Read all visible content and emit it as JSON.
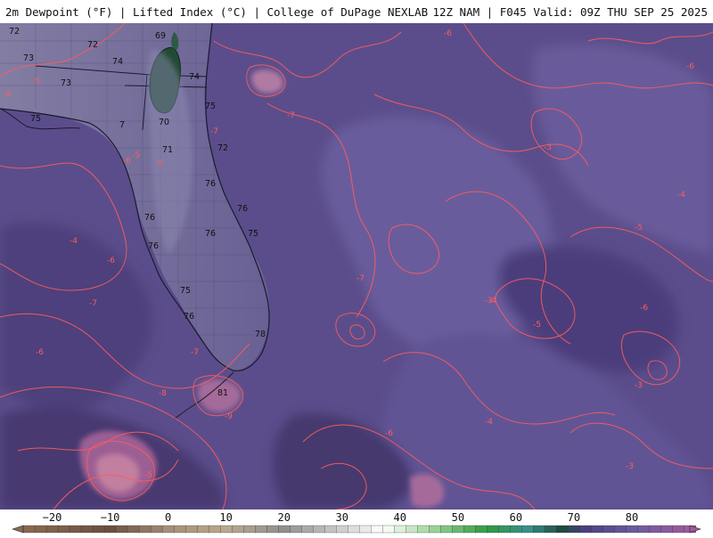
{
  "header": {
    "left": "2m Dewpoint (°F) | Lifted Index (°C) | College of DuPage NEXLAB",
    "right": "12Z NAM | F045 Valid: 09Z THU SEP 25 2025"
  },
  "colors": {
    "background_fill": "#5a4c8a",
    "fill_low_dew": "#4a3d76",
    "fill_mid_dew": "#6a5a9a",
    "fill_high_dew": "#8f5a8a",
    "fill_highest_dew": "#c07a9a",
    "fill_dry_core": "#234a36",
    "li_contour": "#ff5c5c",
    "land_outline": "#1a1a2e"
  },
  "colorbar": {
    "tick_labels": [
      "−20",
      "−10",
      "0",
      "10",
      "20",
      "30",
      "40",
      "50",
      "60",
      "70",
      "80"
    ],
    "tick_values": [
      -20,
      -10,
      0,
      10,
      20,
      30,
      40,
      50,
      60,
      70,
      80
    ],
    "range": [
      -25,
      90
    ],
    "stops": [
      {
        "v": -25,
        "c": "#8a6a52"
      },
      {
        "v": -10,
        "c": "#6b5040"
      },
      {
        "v": 0,
        "c": "#a58f78"
      },
      {
        "v": 10,
        "c": "#b9a88e"
      },
      {
        "v": 20,
        "c": "#8f8f8f"
      },
      {
        "v": 30,
        "c": "#cfcfcf"
      },
      {
        "v": 37,
        "c": "#ffffff"
      },
      {
        "v": 45,
        "c": "#a3d7a0"
      },
      {
        "v": 55,
        "c": "#2f9a40"
      },
      {
        "v": 62,
        "c": "#3a8f8a"
      },
      {
        "v": 68,
        "c": "#1f4a40"
      },
      {
        "v": 72,
        "c": "#4a4080"
      },
      {
        "v": 80,
        "c": "#6a5aa0"
      },
      {
        "v": 90,
        "c": "#a05a9a"
      }
    ]
  },
  "dewpoint_labels": [
    "72",
    "72",
    "73",
    "72",
    "74",
    "69",
    "73",
    "74",
    "75",
    "70",
    "75",
    "7",
    "71",
    "72",
    "76",
    "76",
    "76",
    "76",
    "76",
    "75",
    "75",
    "76",
    "78",
    "81"
  ],
  "lifted_index_labels": [
    "-6",
    "-5",
    "-7",
    "-5",
    "-4",
    "-6",
    "-7",
    "-6",
    "-5",
    "-6",
    "-7",
    "-8",
    "-9",
    "-5",
    "-6",
    "-4",
    "-3",
    "-3",
    "-4",
    "-5",
    "-6",
    "-5",
    "-6",
    "-3",
    "-3",
    "-4",
    "-7",
    "-6",
    "-7"
  ]
}
